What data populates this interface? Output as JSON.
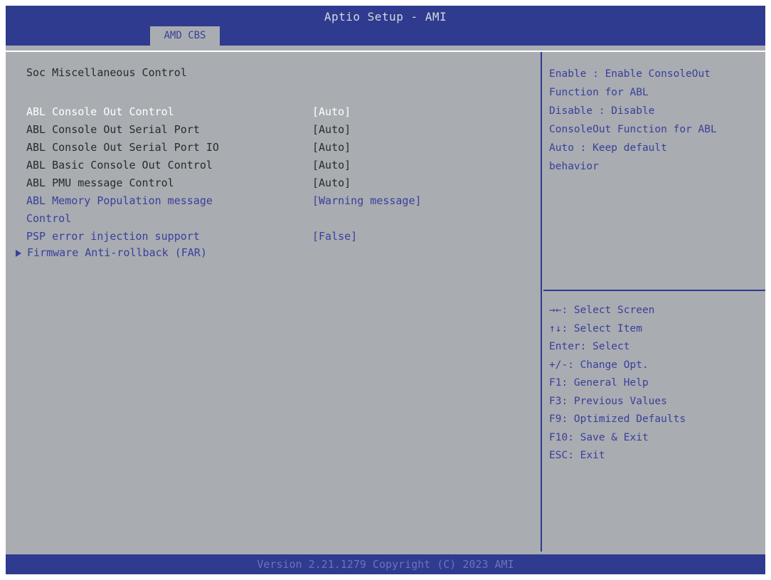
{
  "header": {
    "title": "Aptio Setup - AMI",
    "active_tab": "AMD CBS"
  },
  "main": {
    "section_title": "Soc Miscellaneous Control",
    "settings": [
      {
        "label": "ABL Console Out Control",
        "value": "[Auto]"
      },
      {
        "label": "ABL Console Out Serial Port",
        "value": "[Auto]"
      },
      {
        "label": "ABL Console Out Serial Port IO",
        "value": "[Auto]"
      },
      {
        "label": "ABL Basic Console Out Control",
        "value": "[Auto]"
      },
      {
        "label": "ABL PMU message Control",
        "value": "[Auto]"
      },
      {
        "label": "ABL Memory Population message\nControl",
        "value": "[Warning message]"
      },
      {
        "label": "PSP error injection support",
        "value": "[False]"
      }
    ],
    "submenu": "Firmware Anti-rollback (FAR)"
  },
  "help": {
    "description": "Enable : Enable ConsoleOut\nFunction for ABL\nDisable : Disable\nConsoleOut Function for ABL\nAuto : Keep default\nbehavior"
  },
  "hotkeys": [
    "→←: Select Screen",
    "↑↓: Select Item",
    "Enter: Select",
    "+/-: Change Opt.",
    "F1: General Help",
    "F3: Previous Values",
    "F9: Optimized Defaults",
    "F10: Save & Exit",
    "ESC: Exit"
  ],
  "footer": {
    "version": "Version 2.21.1279 Copyright (C) 2023 AMI"
  },
  "colors": {
    "title_bar": "#2e3b8f",
    "background": "#a9acb1",
    "highlight_text": "#3a3f9a",
    "selected_text": "#ffffff"
  }
}
